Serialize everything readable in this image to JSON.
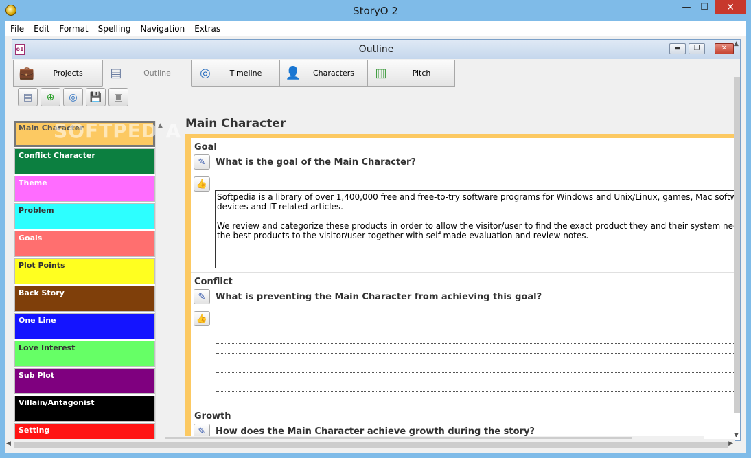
{
  "window": {
    "title": "StoryO 2",
    "min": "—",
    "max": "☐",
    "close": "✕"
  },
  "menu": [
    "File",
    "Edit",
    "Format",
    "Spelling",
    "Navigation",
    "Extras"
  ],
  "child": {
    "title": "Outline",
    "min": "▬",
    "max": "❐",
    "close": "✕",
    "icon_text": "o1"
  },
  "tabs": [
    {
      "label": "Projects",
      "icon": "briefcase-icon",
      "glyph": "💼",
      "active": false
    },
    {
      "label": "Outline",
      "icon": "outline-icon",
      "glyph": "▤",
      "active": true
    },
    {
      "label": "Timeline",
      "icon": "timeline-icon",
      "glyph": "◎",
      "active": false
    },
    {
      "label": "Characters",
      "icon": "characters-icon",
      "glyph": "👤",
      "active": false
    },
    {
      "label": "Pitch",
      "icon": "pitch-icon",
      "glyph": "▥",
      "active": false
    }
  ],
  "toolbar": [
    {
      "name": "outline-view-button",
      "glyph": "▤"
    },
    {
      "name": "add-item-button",
      "glyph": "⊕"
    },
    {
      "name": "timeline-button",
      "glyph": "◎"
    },
    {
      "name": "save-button",
      "glyph": "💾"
    },
    {
      "name": "box-button",
      "glyph": "▣"
    }
  ],
  "watermark": "SOFTPEDIA",
  "categories": [
    {
      "label": "Main Character",
      "bg": "#fcc962",
      "fg": "#555555",
      "selected": true
    },
    {
      "label": "Conflict Character",
      "bg": "#0c7f40",
      "fg": "#ffffff"
    },
    {
      "label": "Theme",
      "bg": "#ff6cff",
      "fg": "#ffffff"
    },
    {
      "label": "Problem",
      "bg": "#2dffff",
      "fg": "#333333"
    },
    {
      "label": "Goals",
      "bg": "#ff6f6f",
      "fg": "#ffffff"
    },
    {
      "label": "Plot Points",
      "bg": "#ffff20",
      "fg": "#333333"
    },
    {
      "label": "Back Story",
      "bg": "#7f3f0a",
      "fg": "#ffffff"
    },
    {
      "label": "One Line",
      "bg": "#1414ff",
      "fg": "#ffffff"
    },
    {
      "label": "Love Interest",
      "bg": "#66ff66",
      "fg": "#333333"
    },
    {
      "label": "Sub Plot",
      "bg": "#7f007f",
      "fg": "#ffffff"
    },
    {
      "label": "Villain/Antagonist",
      "bg": "#000000",
      "fg": "#ffffff"
    },
    {
      "label": "Setting",
      "bg": "#ff1414",
      "fg": "#ffffff"
    }
  ],
  "main": {
    "heading": "Main Character",
    "goal": {
      "title": "Goal",
      "question": "What is the goal of the Main Character?",
      "answer_p1": "Softpedia is a library of over 1,400,000 free and free-to-try software programs for Windows and Unix/Linux, games, Mac software, Windo",
      "answer_p1b": "devices and IT-related articles.",
      "answer_p2": "We review and categorize these products in order to allow the visitor/user to find the exact product they and their system needs. We striv",
      "answer_p2b": "the best products to the visitor/user together with self-made evaluation and review notes."
    },
    "conflict": {
      "title": "Conflict",
      "question": "What is preventing the Main Character from achieving this goal?"
    },
    "growth": {
      "title": "Growth",
      "question": "How does the Main Character achieve growth during the story?"
    }
  },
  "icons": {
    "pen": "✎",
    "thumb": "👍",
    "up": "▲",
    "down": "▼",
    "left": "◀",
    "right": "▶"
  }
}
